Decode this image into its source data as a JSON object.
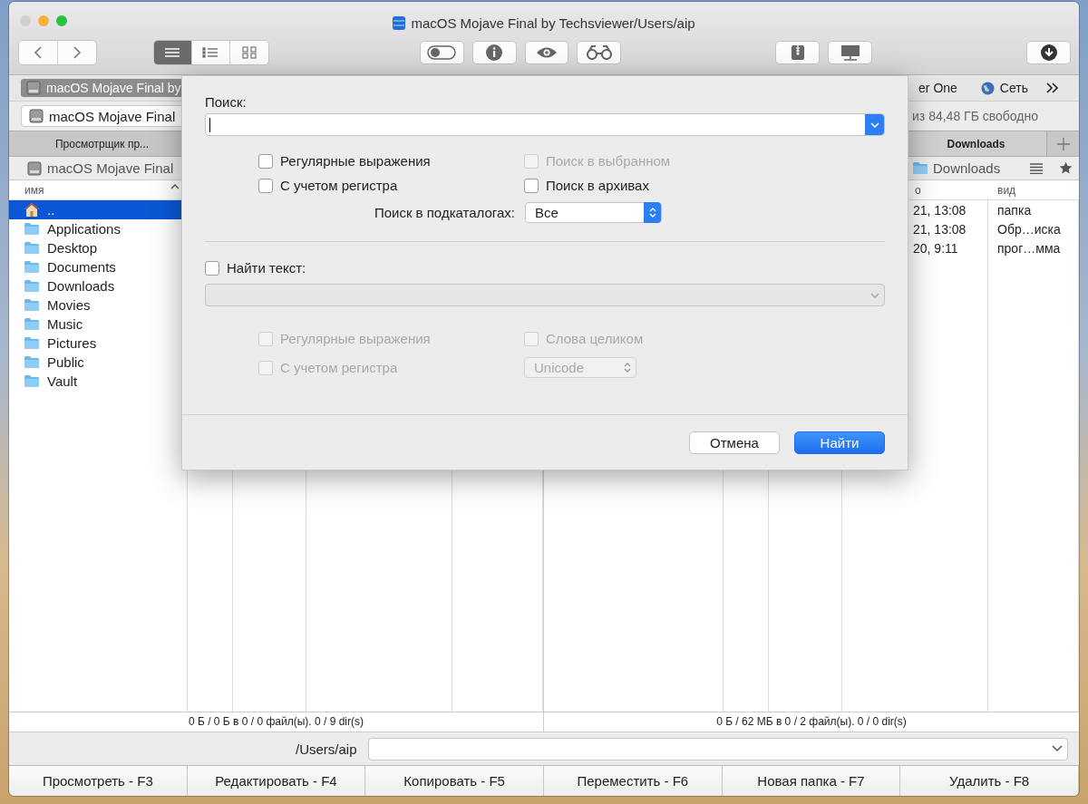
{
  "window": {
    "title": "macOS Mojave Final by Techsviewer/Users/aip"
  },
  "toolbar": {
    "view_modes": [
      {
        "selected": true
      },
      {
        "selected": false
      },
      {
        "selected": false
      }
    ]
  },
  "drives": {
    "items": [
      {
        "label": "macOS Mojave Final by",
        "selected": true
      },
      {
        "label": "er One",
        "selected": false
      },
      {
        "label": "Сеть",
        "selected": false
      }
    ]
  },
  "left_panel": {
    "path": "macOS Mojave Final",
    "tabs": [
      {
        "label": "Просмотрщик пр...",
        "selected": false
      }
    ],
    "breadcrumb": "macOS Mojave Final",
    "columns": [
      "имя"
    ],
    "rows": [
      {
        "name": "..",
        "kind": "parent",
        "selected": true
      },
      {
        "name": "Applications",
        "kind": "folder",
        "selected": false
      },
      {
        "name": "Desktop",
        "kind": "folder",
        "selected": false
      },
      {
        "name": "Documents",
        "kind": "folder",
        "selected": false
      },
      {
        "name": "Downloads",
        "kind": "folder",
        "selected": false
      },
      {
        "name": "Movies",
        "kind": "folder",
        "selected": false
      },
      {
        "name": "Music",
        "kind": "folder",
        "selected": false
      },
      {
        "name": "Pictures",
        "kind": "folder",
        "selected": false
      },
      {
        "name": "Public",
        "kind": "folder",
        "selected": false
      },
      {
        "name": "Vault",
        "kind": "folder",
        "selected": false
      }
    ],
    "status": "0 Б / 0 Б в 0 / 0 файл(ы). 0 / 9 dir(s)"
  },
  "right_panel": {
    "free_space": "из 84,48 ГБ свободно",
    "tabs": [
      {
        "label": "Downloads",
        "selected": true
      }
    ],
    "breadcrumb": "Downloads",
    "columns": [
      "о",
      "вид"
    ],
    "rows": [
      {
        "column_4": "21, 13:08",
        "type": "папка"
      },
      {
        "column_4": "21, 13:08",
        "type": "Обр…иска"
      },
      {
        "column_4": "20, 9:11",
        "type": "прог…мма"
      }
    ],
    "status": "0 Б / 62 МБ в 0 / 2 файл(ы). 0 / 0 dir(s)"
  },
  "command_line": {
    "label": "/Users/aip"
  },
  "function_keys": [
    "Просмотреть - F3",
    "Редактировать - F4",
    "Копировать - F5",
    "Переместить - F6",
    "Новая папка - F7",
    "Удалить - F8"
  ],
  "search_dialog": {
    "search_label": "Поиск:",
    "options": [
      {
        "label": "Регулярные выражения",
        "checked": false,
        "disabled": false
      },
      {
        "label": "Поиск в выбранном",
        "checked": false,
        "disabled": true
      },
      {
        "label": "С учетом регистра",
        "checked": false,
        "disabled": false
      },
      {
        "label": "Поиск в архивах",
        "checked": false,
        "disabled": false
      }
    ],
    "subfolders": {
      "label": "Поиск в подкаталогах:",
      "value": "Все"
    },
    "find_text": {
      "label": "Найти текст:",
      "checked": false,
      "field_disabled": true
    },
    "text_options": [
      {
        "label": "Регулярные выражения",
        "checked": false,
        "disabled": true
      },
      {
        "label": "Слова целиком",
        "checked": false,
        "disabled": true
      },
      {
        "label": "С учетом регистра",
        "checked": false,
        "disabled": true
      }
    ],
    "encoding": {
      "value": "Unicode",
      "disabled": true
    },
    "buttons": [
      {
        "label": "Отмена",
        "default": false
      },
      {
        "label": "Найти",
        "default": true
      }
    ]
  }
}
